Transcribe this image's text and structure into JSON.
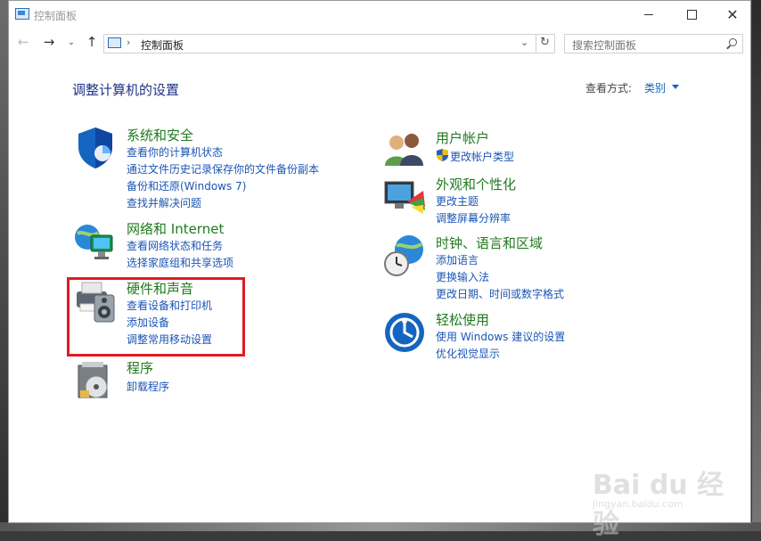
{
  "window": {
    "title": "控制面板"
  },
  "address": {
    "path": "控制面板",
    "separator": "›"
  },
  "search": {
    "placeholder": "搜索控制面板"
  },
  "nav": {
    "back": "←",
    "forward": "→",
    "recent": "⌄",
    "up": "↑",
    "refresh": "↻",
    "dropdown": "⌄"
  },
  "header": {
    "title": "调整计算机的设置",
    "view_by_label": "查看方式:",
    "view_by_value": "类别"
  },
  "categories_left": [
    {
      "title": "系统和安全",
      "icon": "shield-icon",
      "links": [
        "查看你的计算机状态",
        "通过文件历史记录保存你的文件备份副本",
        "备份和还原(Windows 7)",
        "查找并解决问题"
      ]
    },
    {
      "title": "网络和 Internet",
      "icon": "network-globe-icon",
      "links": [
        "查看网络状态和任务",
        "选择家庭组和共享选项"
      ]
    },
    {
      "title": "硬件和声音",
      "icon": "printer-speaker-icon",
      "links": [
        "查看设备和打印机",
        "添加设备",
        "调整常用移动设置"
      ]
    },
    {
      "title": "程序",
      "icon": "programs-disc-icon",
      "links": [
        "卸载程序"
      ]
    }
  ],
  "categories_right": [
    {
      "title": "用户帐户",
      "icon": "users-icon",
      "links": [
        "更改帐户类型"
      ]
    },
    {
      "title": "外观和个性化",
      "icon": "monitor-palette-icon",
      "links": [
        "更改主题",
        "调整屏幕分辨率"
      ]
    },
    {
      "title": "时钟、语言和区域",
      "icon": "clock-globe-icon",
      "links": [
        "添加语言",
        "更换输入法",
        "更改日期、时间或数字格式"
      ]
    },
    {
      "title": "轻松使用",
      "icon": "ease-of-access-icon",
      "links": [
        "使用 Windows 建议的设置",
        "优化视觉显示"
      ]
    }
  ],
  "watermark": {
    "brand": "Bai du 经验",
    "url": "jingyan.baidu.com"
  },
  "colors": {
    "category_title": "#1f7a1f",
    "link": "#1a55b5",
    "highlight": "#e01b24",
    "page_title": "#1e3287"
  }
}
